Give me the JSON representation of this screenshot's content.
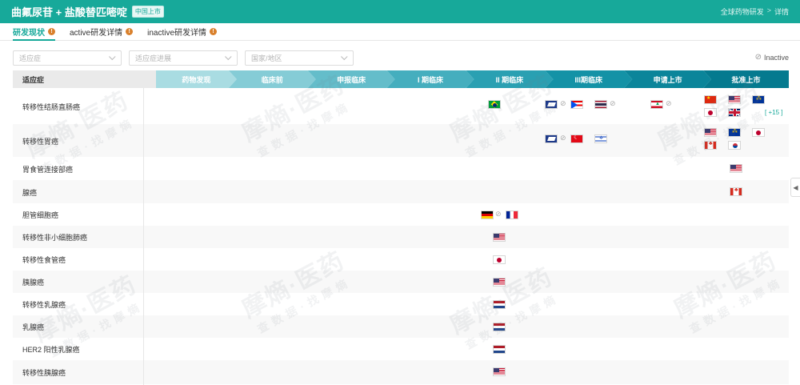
{
  "header": {
    "title": "曲氟尿苷 + 盐酸替匹嘧啶",
    "badge": "中国上市",
    "breadcrumb": [
      "全球药物研发",
      "详情"
    ]
  },
  "tabs": [
    {
      "label": "研发现状",
      "active": true
    },
    {
      "label": "active研发详情",
      "active": false
    },
    {
      "label": "inactive研发详情",
      "active": false
    }
  ],
  "filters": {
    "indication_placeholder": "适应症",
    "stage_placeholder": "适应症进展",
    "country_placeholder": "国家/地区"
  },
  "legend": {
    "inactive_label": "Inactive"
  },
  "table": {
    "indication_header": "适应症",
    "stages": [
      {
        "label": "药物发现",
        "color": "#a9dce2"
      },
      {
        "label": "临床前",
        "color": "#85ccd6"
      },
      {
        "label": "申报临床",
        "color": "#64bdca"
      },
      {
        "label": "I 期临床",
        "color": "#45aebe"
      },
      {
        "label": "II 期临床",
        "color": "#2aa0b2"
      },
      {
        "label": "III期临床",
        "color": "#1492a6"
      },
      {
        "label": "申请上市",
        "color": "#0b859a"
      },
      {
        "label": "批准上市",
        "color": "#057a8f"
      }
    ],
    "rows": [
      {
        "name": "转移性结肠直肠癌"
      },
      {
        "name": "转移性胃癌"
      },
      {
        "name": "胃食管连接部癌"
      },
      {
        "name": "腺癌"
      },
      {
        "name": "胆管细胞癌"
      },
      {
        "name": "转移性非小细胞肺癌"
      },
      {
        "name": "转移性食管癌"
      },
      {
        "name": "胰腺癌"
      },
      {
        "name": "转移性乳腺癌"
      },
      {
        "name": "乳腺癌"
      },
      {
        "name": "HER2 阳性乳腺癌"
      },
      {
        "name": "转移性胰腺癌"
      }
    ],
    "more_label": "[ +15 ]"
  },
  "watermark": {
    "text": "摩熵·医药",
    "sub": "查数据·找摩熵"
  },
  "icons": {
    "inactive": "ban-icon",
    "collapse": "chevron-left-icon",
    "info": "info-icon"
  }
}
